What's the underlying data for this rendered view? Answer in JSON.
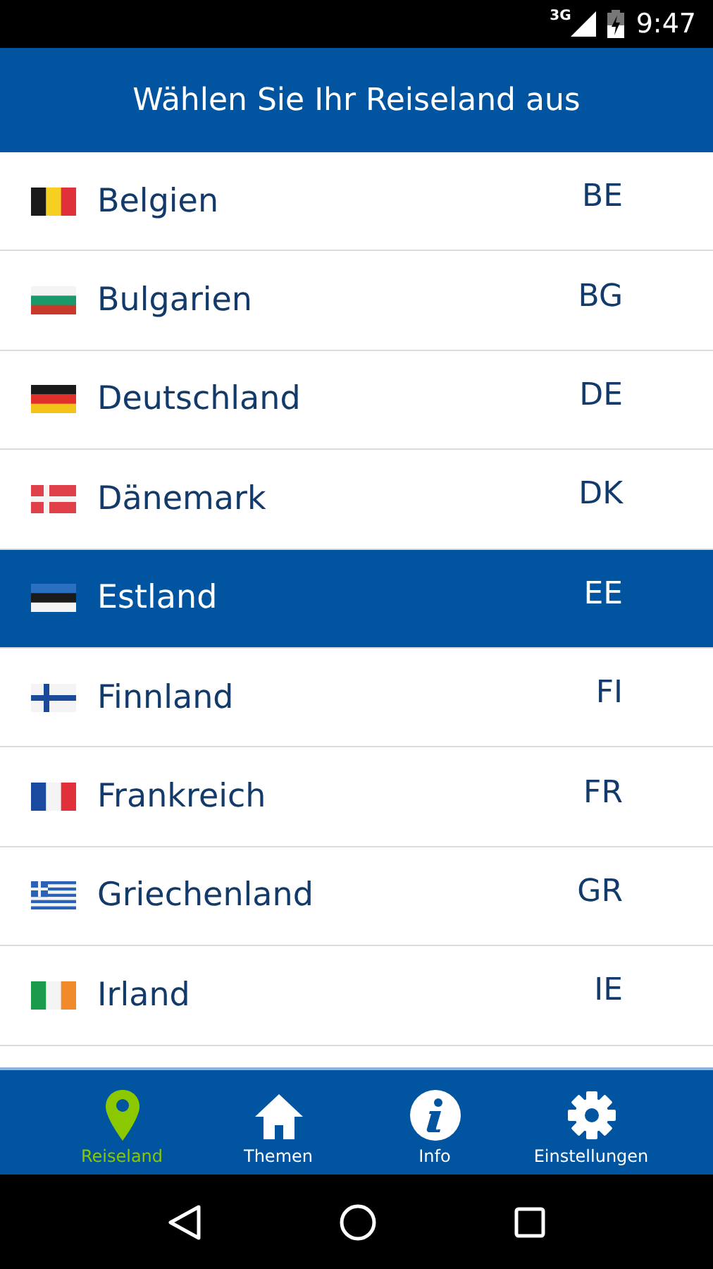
{
  "status_bar": {
    "network": "3G",
    "time": "9:47"
  },
  "header": {
    "title": "Wählen Sie Ihr Reiseland aus"
  },
  "countries": [
    {
      "name": "Belgien",
      "code": "BE",
      "selected": false
    },
    {
      "name": "Bulgarien",
      "code": "BG",
      "selected": false
    },
    {
      "name": "Deutschland",
      "code": "DE",
      "selected": false
    },
    {
      "name": "Dänemark",
      "code": "DK",
      "selected": false
    },
    {
      "name": "Estland",
      "code": "EE",
      "selected": true
    },
    {
      "name": "Finnland",
      "code": "FI",
      "selected": false
    },
    {
      "name": "Frankreich",
      "code": "FR",
      "selected": false
    },
    {
      "name": "Griechenland",
      "code": "GR",
      "selected": false
    },
    {
      "name": "Irland",
      "code": "IE",
      "selected": false
    }
  ],
  "tabs": [
    {
      "label": "Reiseland",
      "selected": true
    },
    {
      "label": "Themen",
      "selected": false
    },
    {
      "label": "Info",
      "selected": false
    },
    {
      "label": "Einstellungen",
      "selected": false
    }
  ]
}
